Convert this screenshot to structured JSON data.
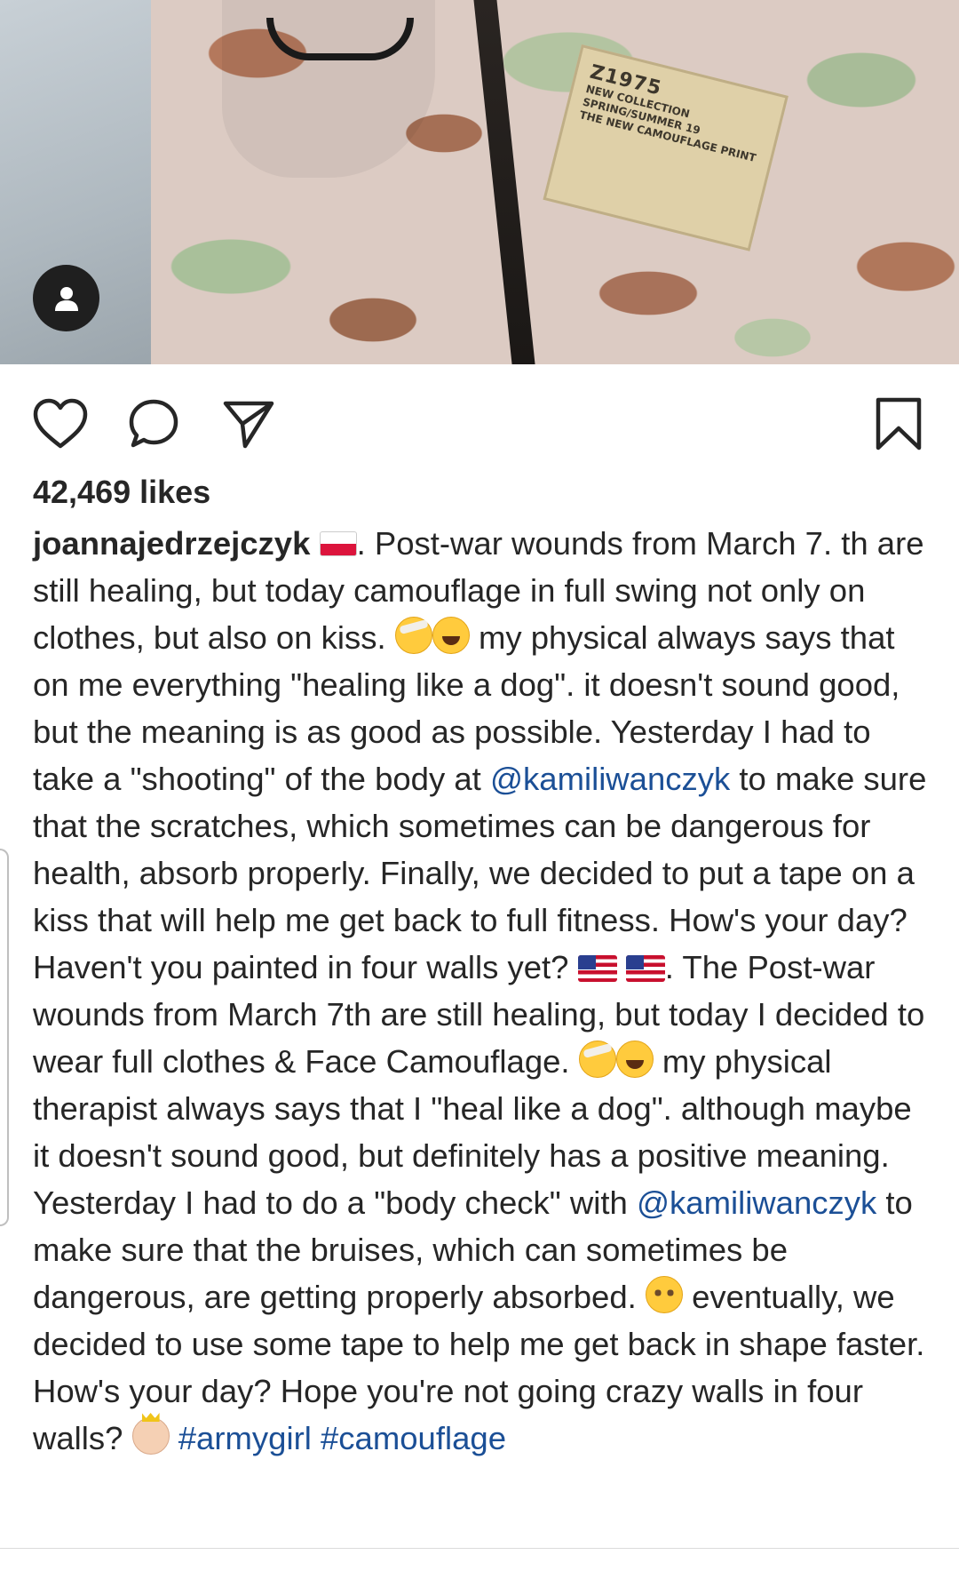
{
  "photo": {
    "patch": {
      "brand": "Z1975",
      "lines": [
        "NEW COLLECTION",
        "SPRING/SUMMER 19",
        "THE NEW CAMOUFLAGE PRINT"
      ]
    }
  },
  "icons": {
    "profile": "user-icon",
    "like": "heart-icon",
    "comment": "comment-icon",
    "share": "send-icon",
    "save": "bookmark-icon"
  },
  "colors": {
    "text": "#262626",
    "link": "#1b4f96"
  },
  "post": {
    "likes": "42,469 likes",
    "username": "joannajedrzejczyk",
    "caption": {
      "p1": ". Post-war wounds from March 7. th are still healing, but today camouflage in full swing not only on clothes, but also on kiss.",
      "p2": " my physical always says that on me everything \"healing like a dog\". it doesn't sound good, but the meaning is as good as possible. Yesterday I had to take a \"shooting\" of the body at ",
      "mention1": "@kamiliwanczyk",
      "p3": " to make sure that the scratches, which sometimes can be dangerous for health, absorb properly. Finally, we decided to put a tape on a kiss that will help me get back to full fitness. How's your day? Haven't you painted in four walls yet?",
      "p4": ". The Post-war wounds from March 7th are still healing, but today I decided to wear full clothes & Face Camouflage.",
      "p5": " my physical therapist always says that I \"heal like a dog\". although maybe it doesn't sound good, but definitely has a positive meaning. Yesterday I had to do a \"body check\" with ",
      "mention2": "@kamiliwanczyk",
      "p6": " to make sure that the bruises, which can sometimes be dangerous, are getting properly absorbed.",
      "p7": " eventually, we decided to use some tape to help me get back in shape faster. How's your day? Hope you're not going crazy walls in four walls?",
      "tag1": "#armygirl",
      "tag2": "#camouflage"
    }
  }
}
